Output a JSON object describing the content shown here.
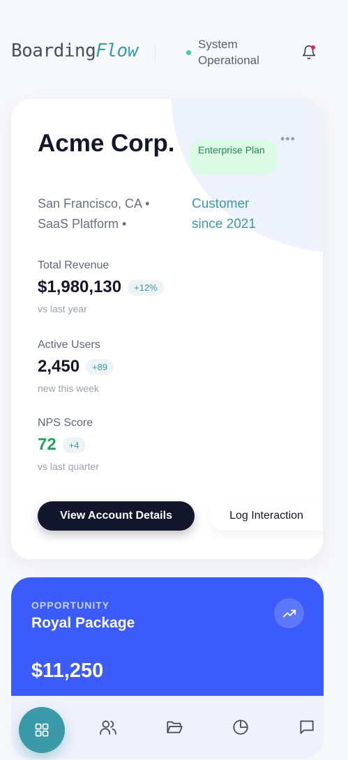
{
  "header": {
    "logo_main": "Boarding",
    "logo_accent": "Flow",
    "status_text": "System Operational"
  },
  "account": {
    "company": "Acme Corp.",
    "plan": "Enterprise Plan",
    "location": "San Francisco, CA • SaaS Platform •",
    "since": "Customer since 2021",
    "metrics": [
      {
        "label": "Total Revenue",
        "value": "$1,980,130",
        "delta": "+12%",
        "sub": "vs last year"
      },
      {
        "label": "Active Users",
        "value": "2,450",
        "delta": "+89",
        "sub": "new this week"
      },
      {
        "label": "NPS Score",
        "value": "72",
        "delta": "+4",
        "sub": "vs last quarter"
      }
    ],
    "primary_button": "View Account Details",
    "secondary_button": "Log Interaction"
  },
  "opportunity": {
    "label": "OPPORTUNITY",
    "title": "Royal Package",
    "value": "$11,250"
  },
  "nav": {
    "items": [
      "grid-icon",
      "users-icon",
      "folder-icon",
      "pie-chart-icon",
      "message-icon"
    ]
  },
  "colors": {
    "accent": "#3b9aa8",
    "primary_dark": "#13152b",
    "opportunity_blue": "#3b5bfb",
    "status_green": "#3fd28e",
    "alert_red": "#e8244a"
  }
}
